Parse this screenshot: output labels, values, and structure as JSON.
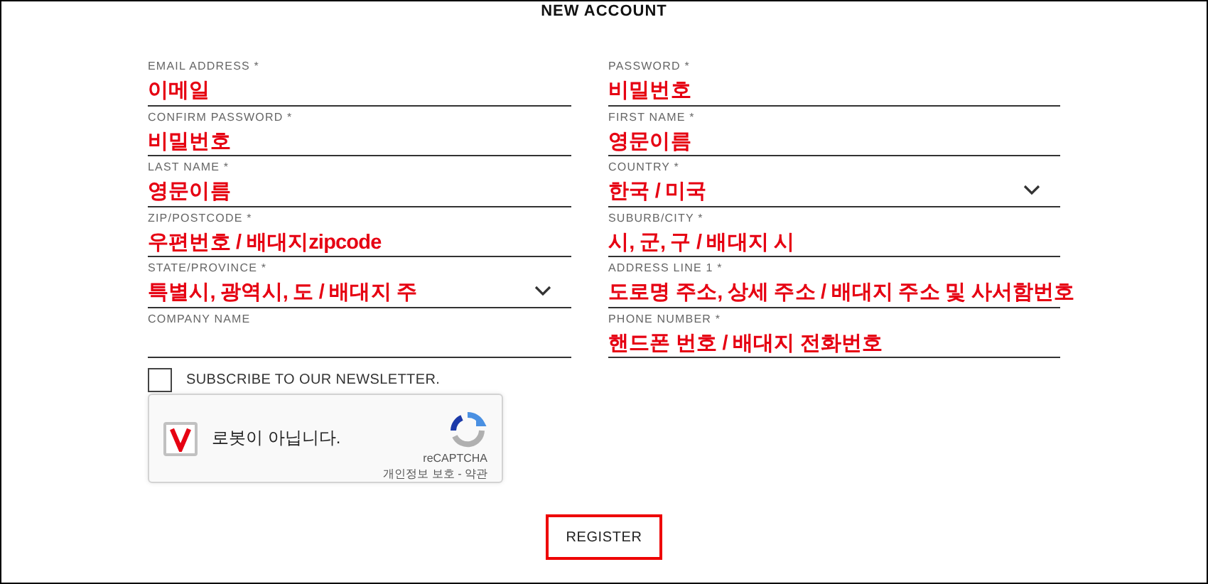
{
  "title": "NEW ACCOUNT",
  "fields": [
    {
      "label": "EMAIL ADDRESS *",
      "value": "이메일",
      "kind": "text"
    },
    {
      "label": "PASSWORD *",
      "value": "비밀번호",
      "kind": "text"
    },
    {
      "label": "CONFIRM PASSWORD *",
      "value": "비밀번호",
      "kind": "text"
    },
    {
      "label": "FIRST NAME *",
      "value": "영문이름",
      "kind": "text"
    },
    {
      "label": "LAST NAME *",
      "value": "영문이름",
      "kind": "text"
    },
    {
      "label": "COUNTRY *",
      "value": "한국 / 미국",
      "kind": "select"
    },
    {
      "label": "ZIP/POSTCODE *",
      "value": "우편번호 / 배대지zipcode",
      "kind": "text"
    },
    {
      "label": "SUBURB/CITY *",
      "value": "시, 군, 구 / 배대지 시",
      "kind": "text"
    },
    {
      "label": "STATE/PROVINCE *",
      "value": "특별시, 광역시, 도 / 배대지 주",
      "kind": "select"
    },
    {
      "label": "ADDRESS LINE 1 *",
      "value": "도로명 주소, 상세 주소 / 배대지 주소 및 사서함번호",
      "kind": "text"
    },
    {
      "label": "COMPANY NAME",
      "kind": "text"
    },
    {
      "label": "PHONE NUMBER *",
      "value": "핸드폰 번호 / 배대지 전화번호",
      "kind": "text"
    }
  ],
  "newsletter": {
    "label": "SUBSCRIBE TO OUR NEWSLETTER.",
    "checked": false
  },
  "captcha": {
    "label": "로봇이 아닙니다.",
    "checked": true,
    "brand": "reCAPTCHA",
    "links": "개인정보 보호 - 약관"
  },
  "register_button": "REGISTER"
}
